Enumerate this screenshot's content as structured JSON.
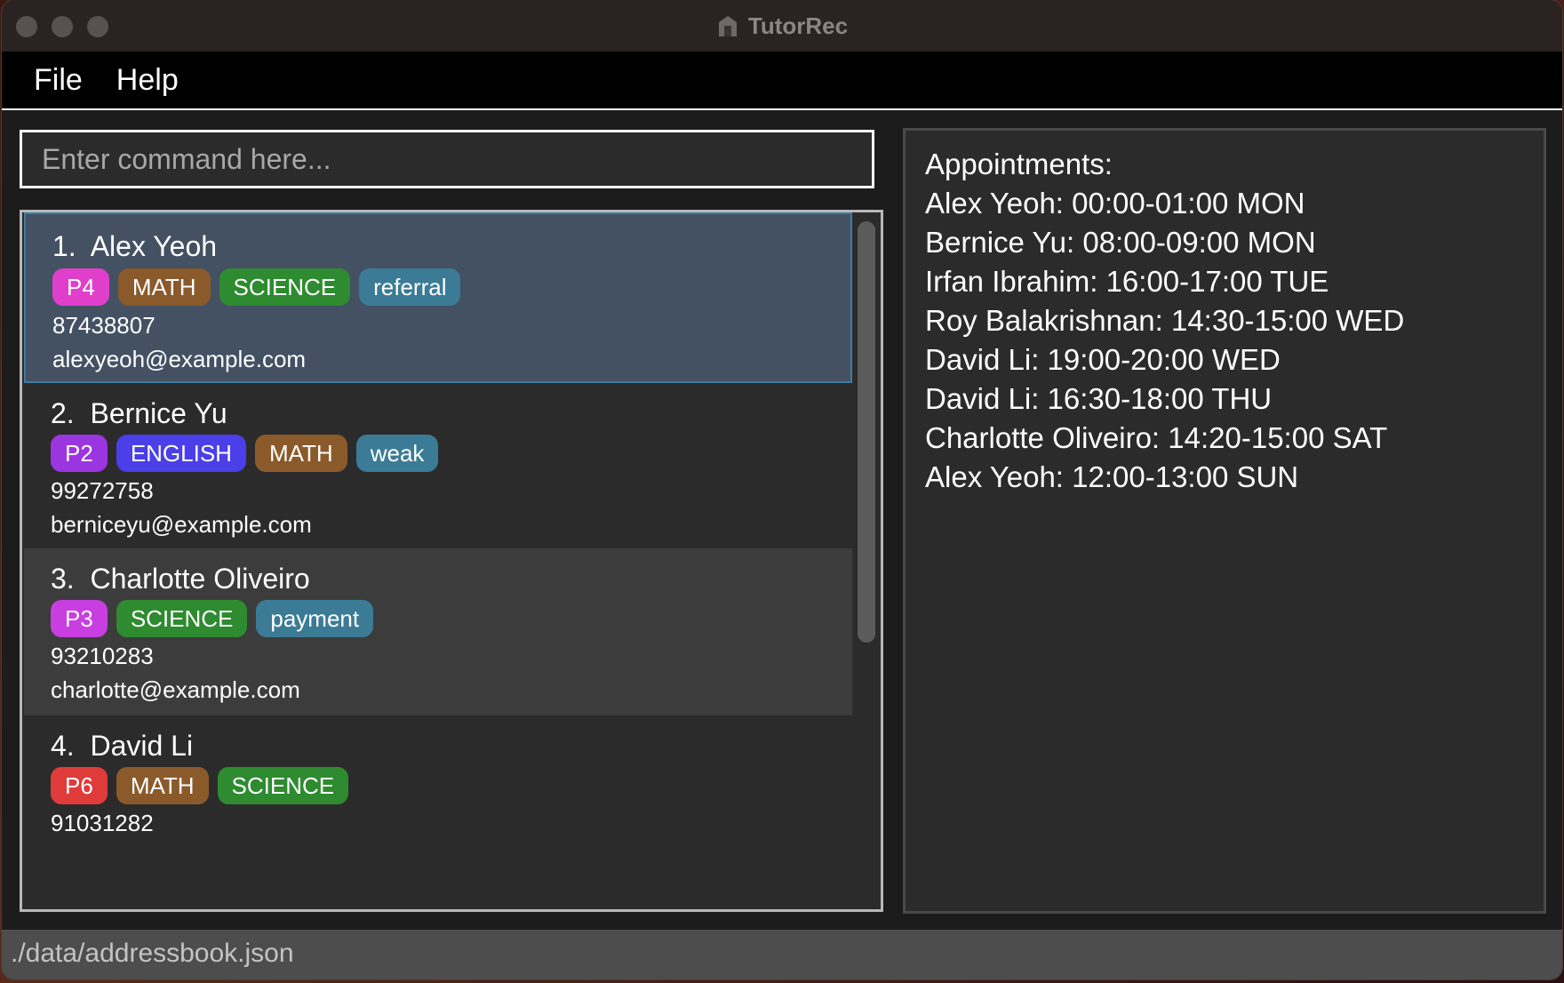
{
  "window": {
    "title": "TutorRec"
  },
  "menu": {
    "file": "File",
    "help": "Help"
  },
  "command": {
    "placeholder": "Enter command here..."
  },
  "persons": [
    {
      "index": "1.",
      "name": "Alex Yeoh",
      "phone": "87438807",
      "email": "alexyeoh@example.com",
      "tags": [
        {
          "label": "P4",
          "color": "#df3fcb"
        },
        {
          "label": "MATH",
          "color": "#8b5a2b"
        },
        {
          "label": "SCIENCE",
          "color": "#2e8b30"
        },
        {
          "label": "referral",
          "color": "#3b7b96"
        }
      ]
    },
    {
      "index": "2.",
      "name": "Bernice Yu",
      "phone": "99272758",
      "email": "berniceyu@example.com",
      "tags": [
        {
          "label": "P2",
          "color": "#9b35e0"
        },
        {
          "label": "ENGLISH",
          "color": "#4a3fe8"
        },
        {
          "label": "MATH",
          "color": "#8b5a2b"
        },
        {
          "label": "weak",
          "color": "#3b7b96"
        }
      ]
    },
    {
      "index": "3.",
      "name": "Charlotte Oliveiro",
      "phone": "93210283",
      "email": "charlotte@example.com",
      "tags": [
        {
          "label": "P3",
          "color": "#c83ee0"
        },
        {
          "label": "SCIENCE",
          "color": "#2e8b30"
        },
        {
          "label": "payment",
          "color": "#3b7b96"
        }
      ]
    },
    {
      "index": "4.",
      "name": "David Li",
      "phone": "91031282",
      "email": "",
      "tags": [
        {
          "label": "P6",
          "color": "#e03b3b"
        },
        {
          "label": "MATH",
          "color": "#8b5a2b"
        },
        {
          "label": "SCIENCE",
          "color": "#2e8b30"
        }
      ]
    }
  ],
  "appointments": {
    "heading": "Appointments:",
    "items": [
      "Alex Yeoh: 00:00-01:00 MON",
      "Bernice Yu: 08:00-09:00 MON",
      "Irfan Ibrahim: 16:00-17:00 TUE",
      "Roy Balakrishnan: 14:30-15:00 WED",
      "David Li: 19:00-20:00 WED",
      "David Li: 16:30-18:00 THU",
      "Charlotte Oliveiro: 14:20-15:00 SAT",
      "Alex Yeoh: 12:00-13:00 SUN"
    ]
  },
  "status": {
    "path": "./data/addressbook.json"
  }
}
